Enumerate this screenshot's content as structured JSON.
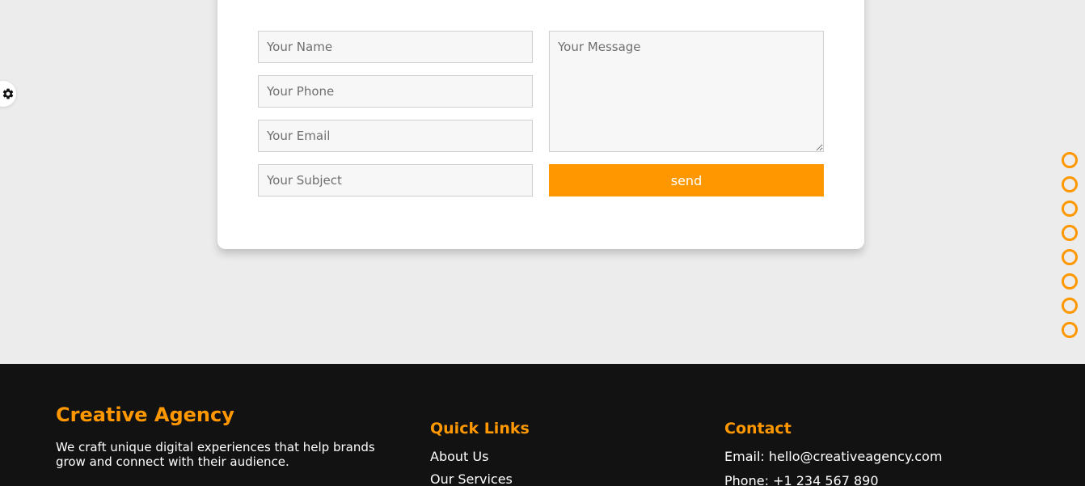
{
  "settings": {
    "icon": "gear-icon"
  },
  "contact_form": {
    "name_placeholder": "Your Name",
    "phone_placeholder": "Your Phone",
    "email_placeholder": "Your Email",
    "subject_placeholder": "Your Subject",
    "message_placeholder": "Your Message",
    "send_label": "send"
  },
  "section_nav": {
    "dot_count": 8
  },
  "footer": {
    "brand": {
      "title": "Creative Agency",
      "description": "We craft unique digital experiences that help brands grow and connect with their audience."
    },
    "quick_links": {
      "title": "Quick Links",
      "items": [
        "About Us",
        "Our Services"
      ]
    },
    "contact": {
      "title": "Contact",
      "email": "Email: hello@creativeagency.com",
      "phone": "Phone: +1 234 567 890"
    }
  },
  "colors": {
    "accent": "#ff9800",
    "page_background": "#ececec",
    "footer_background": "#121212"
  }
}
